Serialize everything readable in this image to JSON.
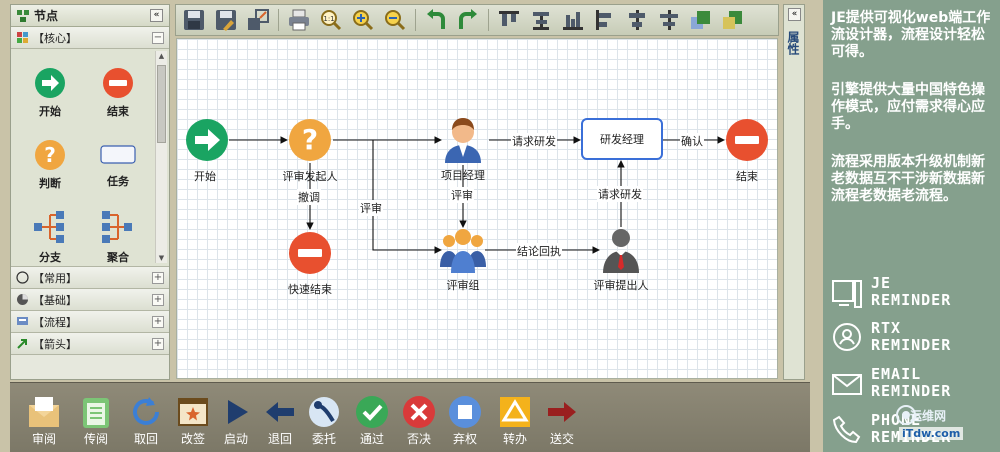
{
  "left_panel": {
    "title": "节点",
    "categories": [
      {
        "label": "【核心】",
        "toggle": "−"
      },
      {
        "label": "【常用】",
        "toggle": "+"
      },
      {
        "label": "【基础】",
        "toggle": "+"
      },
      {
        "label": "【流程】",
        "toggle": "+"
      },
      {
        "label": "【箭头】",
        "toggle": "+"
      }
    ],
    "palette_items": [
      "开始",
      "结束",
      "判断",
      "任务",
      "分支",
      "聚合"
    ],
    "collapse_glyph": "«"
  },
  "properties_panel": {
    "label": "属性",
    "collapse_glyph": "«"
  },
  "toolbar": {
    "icons": [
      "save-icon",
      "save-as-icon",
      "export-icon",
      "print-icon",
      "zoom-fit-icon",
      "zoom-in-icon",
      "zoom-out-icon",
      "undo-icon",
      "redo-icon",
      "align-top-icon",
      "align-middle-icon",
      "align-bottom-icon",
      "align-left-icon",
      "align-center-icon",
      "align-right-icon",
      "bring-front-icon",
      "send-back-icon"
    ]
  },
  "diagram": {
    "nodes": {
      "start": "开始",
      "initiator": "评审发起人",
      "quick_end": "快速结束",
      "pm": "项目经理",
      "review_group": "评审组",
      "submitter": "评审提出人",
      "rd_manager": "研发经理",
      "end": "结束"
    },
    "edges": {
      "withdraw": "撤调",
      "review_1": "评审",
      "review_2": "评审",
      "request_rd_1": "请求研发",
      "request_rd_2": "请求研发",
      "conclusion": "结论回执",
      "confirm": "确认"
    }
  },
  "bottom_bar": {
    "buttons": [
      "审阅",
      "传阅",
      "取回",
      "改签",
      "启动",
      "退回",
      "委托",
      "通过",
      "否决",
      "弃权",
      "转办",
      "送交"
    ]
  },
  "info": {
    "paragraphs": [
      "JE提供可视化web端工作流设计器，流程设计轻松可得。",
      "引擎提供大量中国特色操作模式，应付需求得心应手。",
      "流程采用版本升级机制新老数据互不干涉新数据新流程老数据老流程。"
    ],
    "reminders": [
      {
        "line1": "JE",
        "line2": "REMINDER"
      },
      {
        "line1": "RTX",
        "line2": "REMINDER"
      },
      {
        "line1": "EMAIL",
        "line2": "REMINDER"
      },
      {
        "line1": "PHONE",
        "line2": "REMINDER"
      }
    ]
  },
  "watermark": {
    "site": "运维网",
    "domain": "iTdw.com"
  }
}
